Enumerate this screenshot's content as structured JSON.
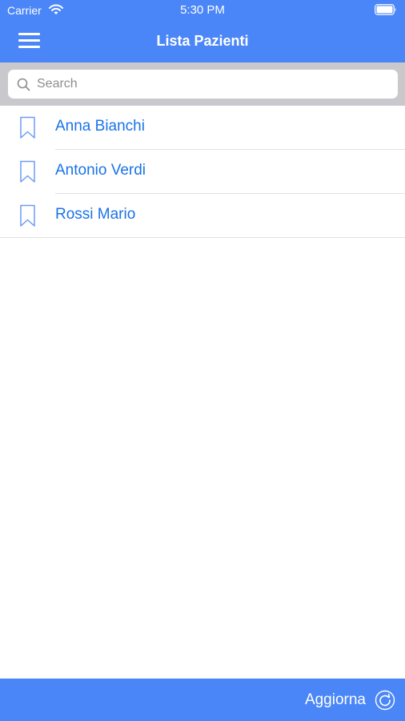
{
  "status_bar": {
    "carrier": "Carrier",
    "time": "5:30 PM"
  },
  "nav": {
    "title": "Lista Pazienti",
    "menu_icon": "hamburger-menu-icon"
  },
  "search": {
    "placeholder": "Search",
    "value": "",
    "icon": "search-icon"
  },
  "patients": [
    {
      "name": "Anna Bianchi",
      "icon": "bookmark-icon"
    },
    {
      "name": "Antonio Verdi",
      "icon": "bookmark-icon"
    },
    {
      "name": "Rossi Mario",
      "icon": "bookmark-icon"
    }
  ],
  "toolbar": {
    "refresh_label": "Aggiorna",
    "refresh_icon": "refresh-icon"
  },
  "colors": {
    "accent": "#4a86f7",
    "link": "#1a73e8",
    "search_bg": "#c9c9cd",
    "separator": "#e2e2e5"
  }
}
